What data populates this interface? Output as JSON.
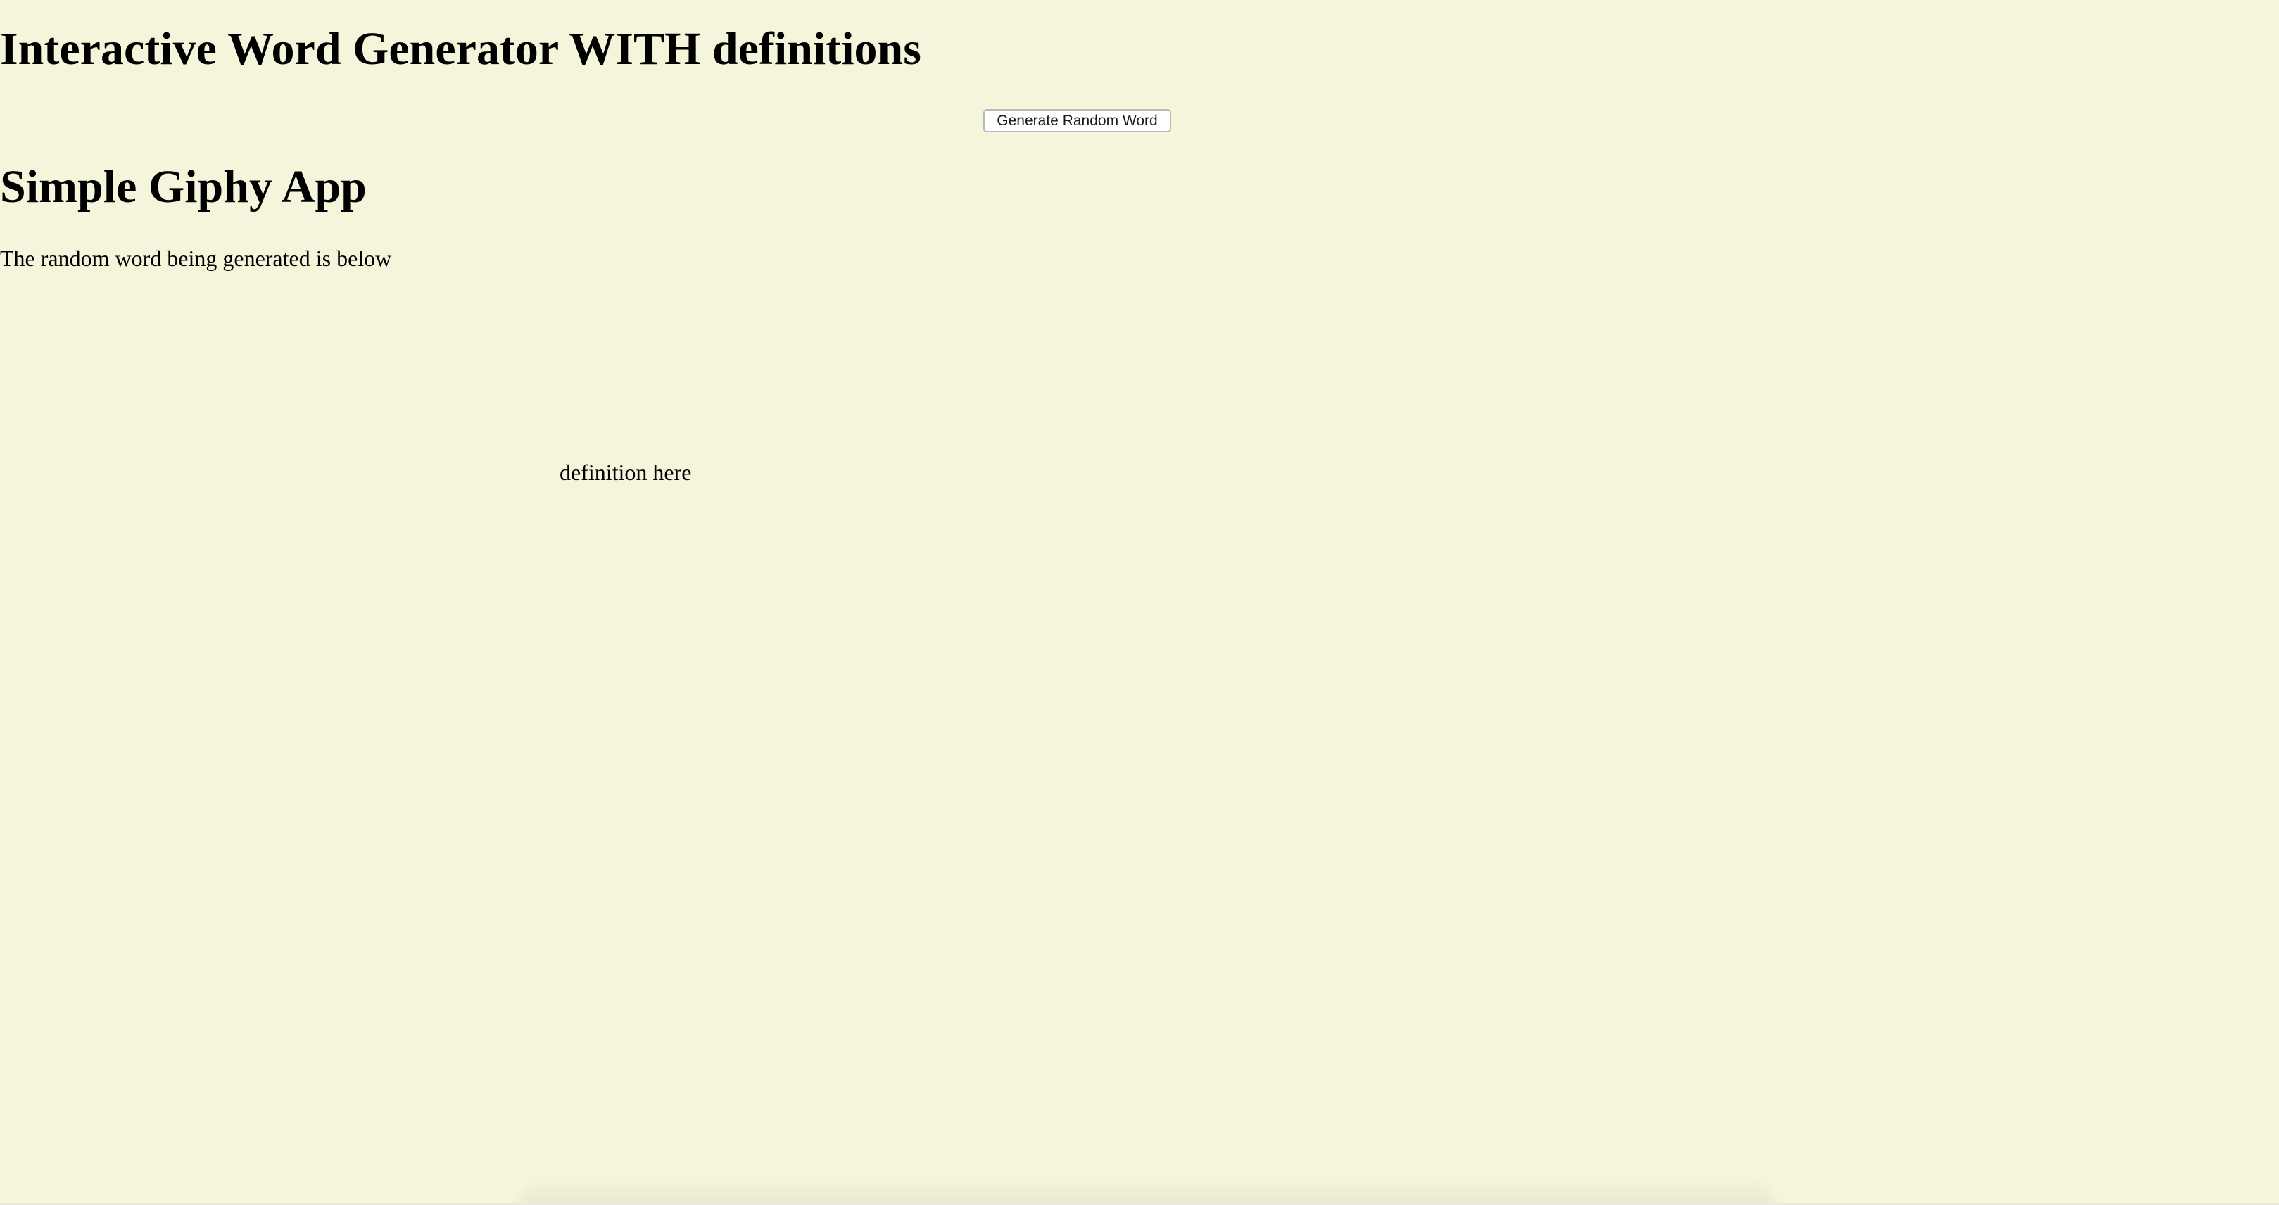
{
  "page": {
    "background_color": "#f5f5dc"
  },
  "header": {
    "title": "Interactive Word Generator WITH definitions"
  },
  "controls": {
    "generate_button_label": "Generate Random Word"
  },
  "app": {
    "title": "Simple Giphy App",
    "intro_text": "The random word being generated is below",
    "definition_text": "definition here"
  }
}
